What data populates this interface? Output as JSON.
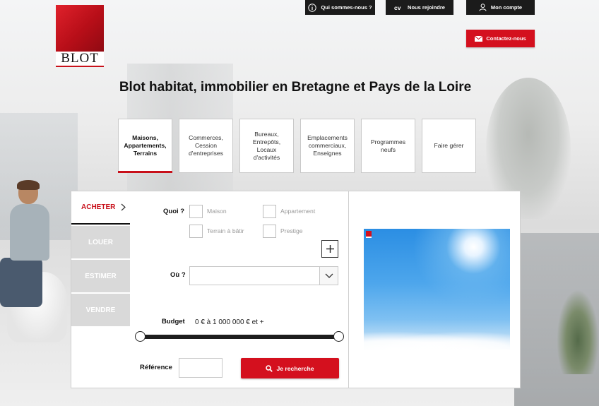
{
  "brand": {
    "logo_text": "BLOT"
  },
  "header": {
    "who": "Qui sommes-nous ?",
    "join": "Nous rejoindre",
    "account": "Mon compte",
    "contact": "Contactez-nous",
    "title": "Blot habitat, immobilier en Bretagne et Pays de la Loire"
  },
  "categories": [
    {
      "label": "Maisons, Appartements, Terrains",
      "active": true
    },
    {
      "label": "Commerces, Cession d'entreprises",
      "active": false
    },
    {
      "label": "Bureaux, Entrepôts, Locaux d'activités",
      "active": false
    },
    {
      "label": "Emplacements commerciaux, Enseignes",
      "active": false
    },
    {
      "label": "Programmes neufs",
      "active": false
    },
    {
      "label": "Faire gérer",
      "active": false
    }
  ],
  "side_tabs": [
    "ACHETER",
    "LOUER",
    "ESTIMER",
    "VENDRE"
  ],
  "search": {
    "quoi_label": "Quoi ?",
    "types": [
      "Maison",
      "Appartement",
      "Terrain à bâtir",
      "Prestige"
    ],
    "ou_label": "Où ?",
    "ou_value": "",
    "budget_label": "Budget",
    "budget_value": "0 € à 1 000 000 € et +",
    "budget_min_fraction": 0,
    "budget_max_fraction": 1,
    "reference_label": "Référence",
    "reference_value": "",
    "submit": "Je recherche"
  },
  "colors": {
    "brand_red": "#d4101e",
    "dark": "#1b1b1b"
  }
}
